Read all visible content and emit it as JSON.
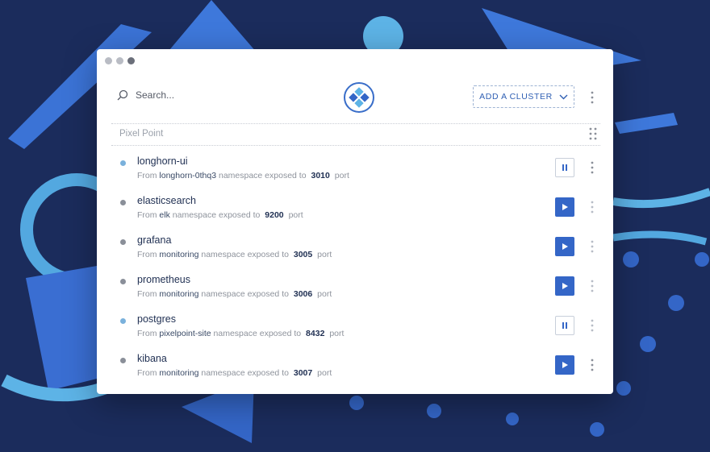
{
  "colors": {
    "background": "#1b2c5c",
    "accent": "#3466c7",
    "active_status": "#7ab1dc",
    "idle_status": "#8a8f99"
  },
  "search": {
    "placeholder": "Search...",
    "icon": "search-icon"
  },
  "header": {
    "add_cluster_label": "ADD A CLUSTER",
    "logo": "kubernetes-port-forward-logo"
  },
  "group": {
    "name": "Pixel Point"
  },
  "services": [
    {
      "name": "longhorn-ui",
      "prefix": "From",
      "namespace": "longhorn-0thq3",
      "middle": "namespace exposed to",
      "port": "3010",
      "suffix": "port",
      "status": "active",
      "action": "pause"
    },
    {
      "name": "elasticsearch",
      "prefix": "From",
      "namespace": "elk",
      "middle": "namespace exposed to",
      "port": "9200",
      "suffix": "port",
      "status": "idle",
      "action": "play"
    },
    {
      "name": "grafana",
      "prefix": "From",
      "namespace": "monitoring",
      "middle": "namespace exposed to",
      "port": "3005",
      "suffix": "port",
      "status": "idle",
      "action": "play"
    },
    {
      "name": "prometheus",
      "prefix": "From",
      "namespace": "monitoring",
      "middle": "namespace exposed to",
      "port": "3006",
      "suffix": "port",
      "status": "idle",
      "action": "play"
    },
    {
      "name": "postgres",
      "prefix": "From",
      "namespace": "pixelpoint-site",
      "middle": "namespace exposed to",
      "port": "8432",
      "suffix": "port",
      "status": "active",
      "action": "pause"
    },
    {
      "name": "kibana",
      "prefix": "From",
      "namespace": "monitoring",
      "middle": "namespace exposed to",
      "port": "3007",
      "suffix": "port",
      "status": "idle",
      "action": "play"
    }
  ]
}
